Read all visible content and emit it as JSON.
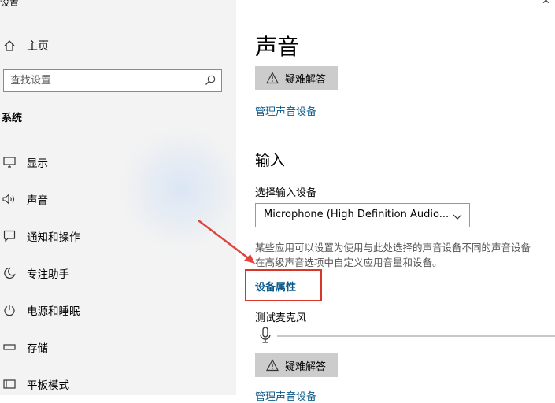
{
  "window": {
    "title": "设置"
  },
  "sidebar": {
    "home_label": "主页",
    "search_placeholder": "查找设置",
    "section": "系统",
    "items": [
      {
        "label": "显示",
        "icon": "monitor-icon"
      },
      {
        "label": "声音",
        "icon": "speaker-icon"
      },
      {
        "label": "通知和操作",
        "icon": "notification-icon"
      },
      {
        "label": "专注助手",
        "icon": "moon-icon"
      },
      {
        "label": "电源和睡眠",
        "icon": "power-icon"
      },
      {
        "label": "存储",
        "icon": "storage-icon"
      },
      {
        "label": "平板模式",
        "icon": "tablet-icon"
      }
    ]
  },
  "main": {
    "title": "声音",
    "troubleshoot_label": "疑难解答",
    "manage_devices_link": "管理声音设备",
    "input_heading": "输入",
    "choose_input_label": "选择输入设备",
    "input_device_selected": "Microphone (High Definition Audio...",
    "description_line1": "某些应用可以设置为使用与此处选择的声音设备不同的声音设备",
    "description_line2": "在高级声音选项中自定义应用音量和设备。",
    "device_properties_link": "设备属性",
    "test_mic_label": "测试麦克风",
    "troubleshoot2_label": "疑难解答",
    "manage_devices_link2": "管理声音设备"
  },
  "colors": {
    "highlight": "#d9362b",
    "arrow": "#e0443a",
    "link": "#0a5a8a",
    "button": "#cccccc"
  }
}
